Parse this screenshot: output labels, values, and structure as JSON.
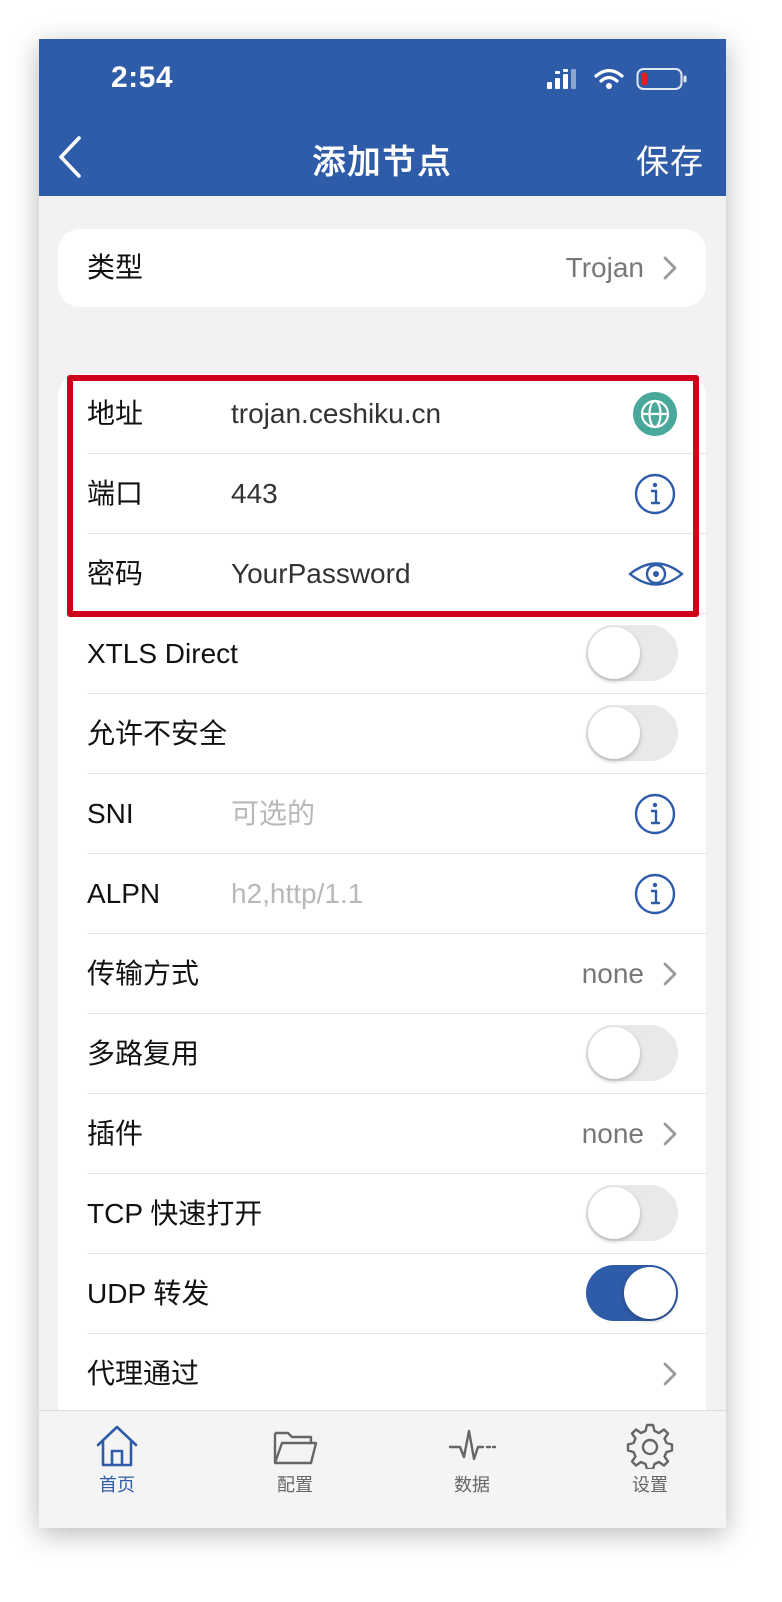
{
  "status_bar": {
    "time": "2:54"
  },
  "nav": {
    "title": "添加节点",
    "save_label": "保存"
  },
  "type_row": {
    "label": "类型",
    "value": "Trojan"
  },
  "fields": {
    "address": {
      "label": "地址",
      "value": "trojan.ceshiku.cn"
    },
    "port": {
      "label": "端口",
      "value": "443"
    },
    "password": {
      "label": "密码",
      "value": "YourPassword"
    },
    "xtls": {
      "label": "XTLS Direct",
      "on": false
    },
    "insecure": {
      "label": "允许不安全",
      "on": false
    },
    "sni": {
      "label": "SNI",
      "placeholder": "可选的"
    },
    "alpn": {
      "label": "ALPN",
      "placeholder": "h2,http/1.1"
    },
    "transport": {
      "label": "传输方式",
      "value": "none"
    },
    "mux": {
      "label": "多路复用",
      "on": false
    },
    "plugin": {
      "label": "插件",
      "value": "none"
    },
    "tcp_fast_open": {
      "label": "TCP 快速打开",
      "on": false
    },
    "udp_relay": {
      "label": "UDP 转发",
      "on": true
    },
    "proxy_via": {
      "label": "代理通过"
    }
  },
  "tabs": [
    {
      "label": "首页",
      "icon": "home-icon",
      "active": true
    },
    {
      "label": "配置",
      "icon": "folder-icon",
      "active": false
    },
    {
      "label": "数据",
      "icon": "activity-icon",
      "active": false
    },
    {
      "label": "设置",
      "icon": "gear-icon",
      "active": false
    }
  ],
  "colors": {
    "brand": "#2f5ca8",
    "highlight": "#d0021b",
    "globe_icon": "#4aa89a",
    "battery_low": "#e02020"
  }
}
